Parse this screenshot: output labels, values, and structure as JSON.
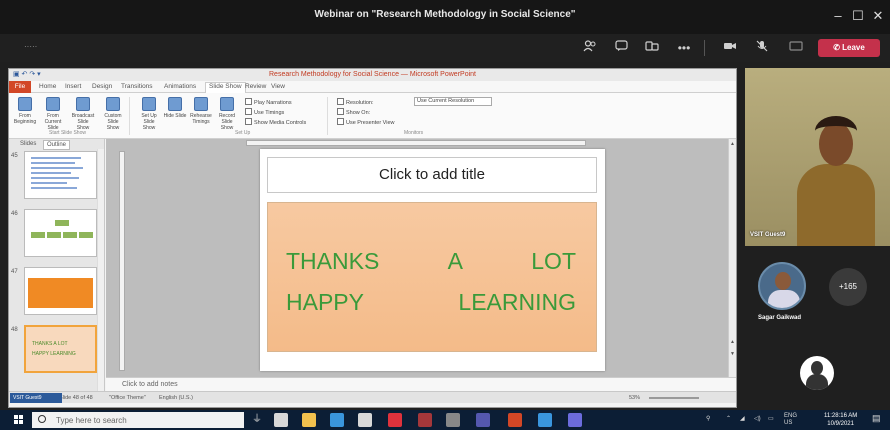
{
  "window": {
    "title": "Webinar on \"Research Methodology in Social Science\"",
    "min": "–",
    "max": "☐",
    "close": "✕"
  },
  "meeting": {
    "timer": "·····",
    "leave_label": "Leave",
    "controls": [
      "participants-icon",
      "chat-icon",
      "react-icon",
      "more-icon",
      "camera-icon",
      "mic-icon",
      "share-icon"
    ],
    "colors": {
      "leave": "#c4314b"
    }
  },
  "ppt": {
    "title": "Research Methodology for Social Science — Microsoft PowerPoint",
    "quick_access": "▣ ↶ ↷ ▾",
    "tabs": [
      "File",
      "Home",
      "Insert",
      "Design",
      "Transitions",
      "Animations",
      "Slide Show",
      "Review",
      "View"
    ],
    "active_tab": "Slide Show",
    "ribbon": {
      "buttons": [
        "From Beginning",
        "From Current Slide",
        "Broadcast Slide Show",
        "Custom Slide Show",
        "Set Up Slide Show",
        "Hide Slide",
        "Rehearse Timings",
        "Record Slide Show"
      ],
      "groups": [
        "Start Slide Show",
        "Set Up",
        "Monitors"
      ],
      "checks": [
        "Play Narrations",
        "Use Timings",
        "Show Media Controls",
        "Use Presenter View"
      ],
      "resolution_label": "Resolution:",
      "resolution_value": "Use Current Resolution",
      "show_on": "Show On:"
    },
    "panel_tabs": [
      "Slides",
      "Outline"
    ],
    "thumbnails": [
      {
        "num": "45",
        "kind": "text"
      },
      {
        "num": "46",
        "kind": "boxes"
      },
      {
        "num": "47",
        "kind": "orange"
      },
      {
        "num": "48",
        "kind": "thanks",
        "line1": "THANKS  A  LOT",
        "line2": "HAPPY  LEARNING"
      }
    ],
    "slide": {
      "title_placeholder": "Click to add title",
      "line1": [
        "THANKS",
        "A",
        "LOT"
      ],
      "line2": [
        "HAPPY",
        "LEARNING"
      ]
    },
    "notes_placeholder": "Click to add notes",
    "status": {
      "slide_info": "Slide 48 of 48",
      "theme": "\"Office Theme\"",
      "language": "English (U.S.)",
      "zoom": "53%"
    }
  },
  "participants": {
    "cam_name": "VSIT Guest9",
    "avatar_name": "Sagar Gaikwad",
    "more_count": "+165"
  },
  "overlay": {
    "guest_label": "VSIT Guest9"
  },
  "taskbar": {
    "search_placeholder": "Type here to search",
    "apps": [
      {
        "name": "task-view-icon",
        "color": "#d8d8d8"
      },
      {
        "name": "file-explorer-icon",
        "color": "#f2c14e"
      },
      {
        "name": "edge-icon",
        "color": "#3a96dd"
      },
      {
        "name": "store-icon",
        "color": "#d8d8d8"
      },
      {
        "name": "opera-icon",
        "color": "#e0323c"
      },
      {
        "name": "access-icon",
        "color": "#a4373a"
      },
      {
        "name": "network-icon",
        "color": "#888888"
      },
      {
        "name": "teams-icon",
        "color": "#5558af"
      },
      {
        "name": "powerpoint-icon",
        "color": "#d24726"
      },
      {
        "name": "onedrive-icon",
        "color": "#3a96dd"
      },
      {
        "name": "settings-icon",
        "color": "#6c6cdc"
      }
    ],
    "language": "ENG",
    "region": "US",
    "time": "11:28:16 AM",
    "date": "10/9/2021",
    "notification_icon": "notification-icon"
  }
}
